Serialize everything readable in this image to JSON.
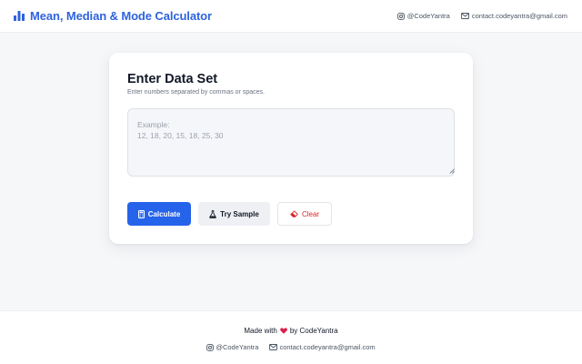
{
  "header": {
    "title": "Mean, Median & Mode Calculator",
    "brand_icon": "bar-chart-icon",
    "instagram": "@CodeYantra",
    "email": "contact.codeyantra@gmail.com"
  },
  "card": {
    "title": "Enter Data Set",
    "subtitle": "Enter numbers separated by commas or spaces.",
    "input_value": "",
    "input_placeholder": "Example:\n12, 18, 20, 15, 18, 25, 30"
  },
  "buttons": {
    "calculate": "Calculate",
    "sample": "Try Sample",
    "clear": "Clear"
  },
  "footer": {
    "made_with_prefix": "Made with",
    "made_with_suffix": "by CodeYantra",
    "instagram": "@CodeYantra",
    "email": "contact.codeyantra@gmail.com"
  },
  "colors": {
    "brand": "#2e63de",
    "primary_button": "#2563eb",
    "clear_text": "#dc2626",
    "heart": "#e11d48"
  }
}
